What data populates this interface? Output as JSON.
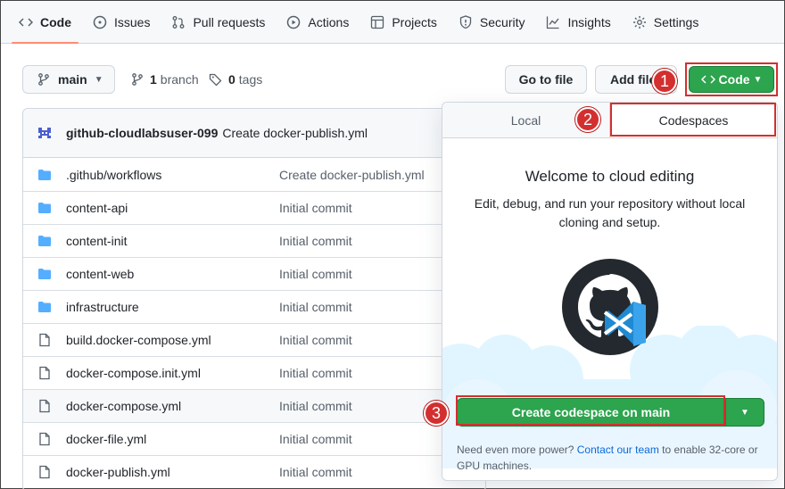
{
  "nav": {
    "items": [
      {
        "label": "Code",
        "icon": "code-icon",
        "active": true
      },
      {
        "label": "Issues",
        "icon": "issue-opened-icon"
      },
      {
        "label": "Pull requests",
        "icon": "git-pull-request-icon"
      },
      {
        "label": "Actions",
        "icon": "play-icon"
      },
      {
        "label": "Projects",
        "icon": "table-icon"
      },
      {
        "label": "Security",
        "icon": "shield-icon"
      },
      {
        "label": "Insights",
        "icon": "graph-icon"
      },
      {
        "label": "Settings",
        "icon": "gear-icon"
      }
    ]
  },
  "toolbar": {
    "branch": "main",
    "branches_count": "1",
    "branches_label": "branch",
    "tags_count": "0",
    "tags_label": "tags",
    "goto_file": "Go to file",
    "add_file": "Add file",
    "code_button": "Code"
  },
  "commit": {
    "user": "github-cloudlabsuser-099",
    "message": "Create docker-publish.yml"
  },
  "files": [
    {
      "name": ".github/workflows",
      "message": "Create docker-publish.yml",
      "type": "folder"
    },
    {
      "name": "content-api",
      "message": "Initial commit",
      "type": "folder"
    },
    {
      "name": "content-init",
      "message": "Initial commit",
      "type": "folder"
    },
    {
      "name": "content-web",
      "message": "Initial commit",
      "type": "folder"
    },
    {
      "name": "infrastructure",
      "message": "Initial commit",
      "type": "folder"
    },
    {
      "name": "build.docker-compose.yml",
      "message": "Initial commit",
      "type": "file"
    },
    {
      "name": "docker-compose.init.yml",
      "message": "Initial commit",
      "type": "file"
    },
    {
      "name": "docker-compose.yml",
      "message": "Initial commit",
      "type": "file"
    },
    {
      "name": "docker-file.yml",
      "message": "Initial commit",
      "type": "file"
    },
    {
      "name": "docker-publish.yml",
      "message": "Initial commit",
      "type": "file"
    }
  ],
  "panel": {
    "tab_local": "Local",
    "tab_codespaces": "Codespaces",
    "welcome_title": "Welcome to cloud editing",
    "welcome_text": "Edit, debug, and run your repository without local cloning and setup.",
    "create_button": "Create codespace on main",
    "power_prefix": "Need even more power?",
    "power_link": "Contact our team",
    "power_suffix": "to enable 32-core or GPU machines."
  },
  "callouts": [
    "1",
    "2",
    "3"
  ],
  "colors": {
    "accent_green": "#2da44e",
    "callout_red": "#d32f2f",
    "folder_blue": "#54aeff",
    "nav_underline": "#fd8c73"
  }
}
